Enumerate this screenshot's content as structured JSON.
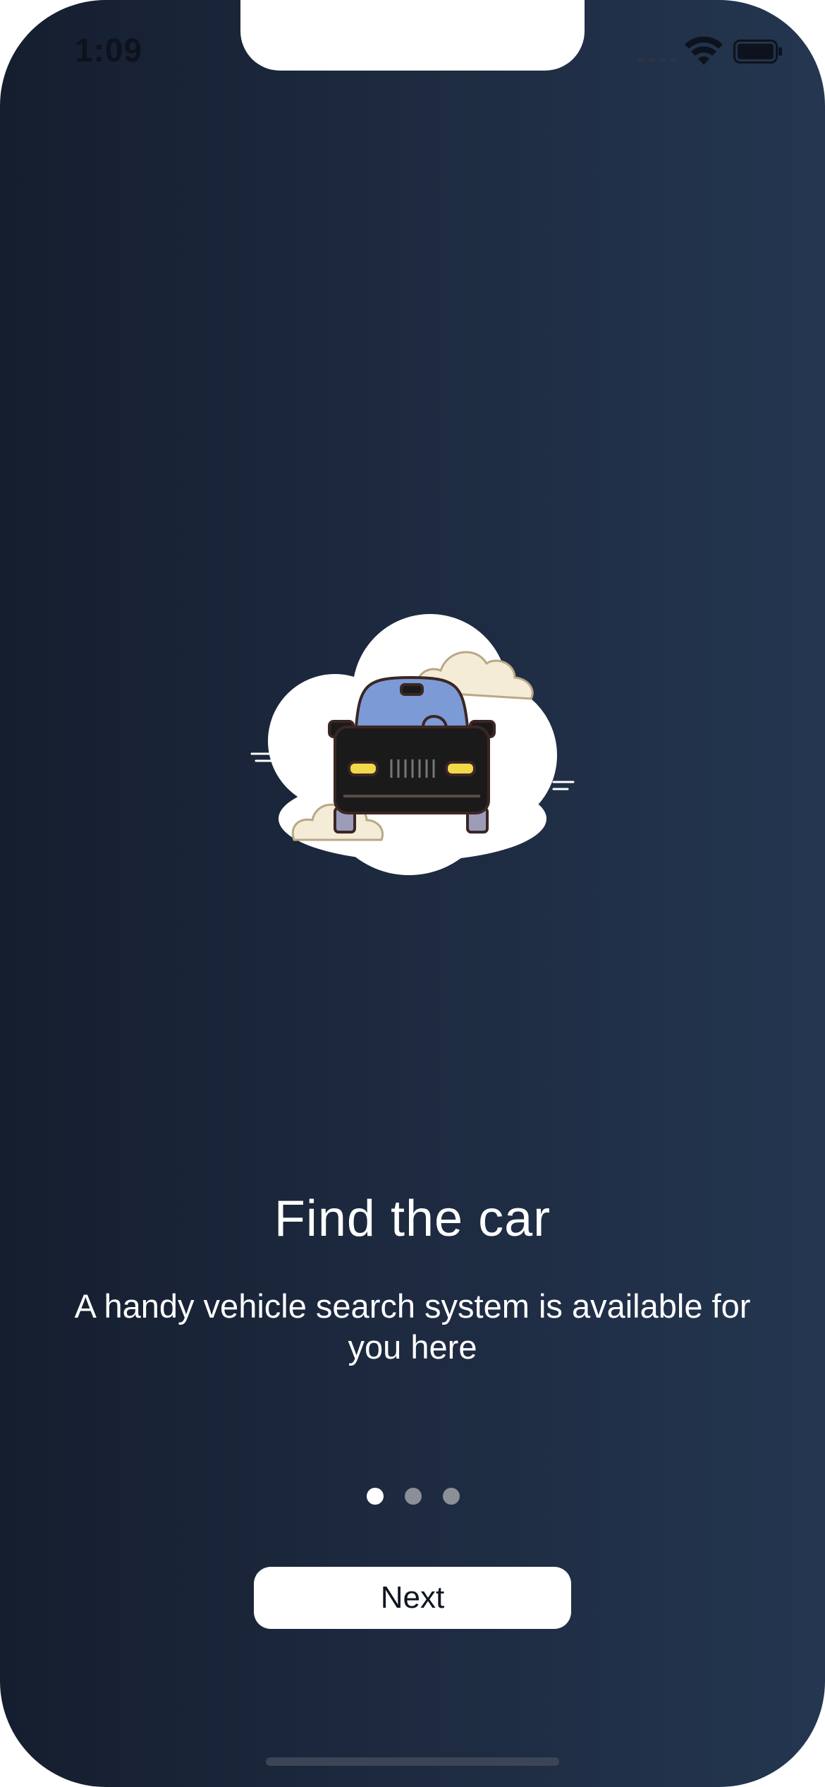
{
  "status_bar": {
    "time": "1:09"
  },
  "onboarding": {
    "title": "Find the car",
    "description": "A handy vehicle search system is available for you here",
    "page_indicator": {
      "total": 3,
      "active_index": 0
    },
    "next_label": "Next"
  },
  "icons": {
    "hero": "car-in-cloud-illustration",
    "wifi": "wifi-icon",
    "battery": "battery-icon",
    "signal": "cellular-signal-icon"
  },
  "colors": {
    "background_start": "#151e2f",
    "background_end": "#243650",
    "text": "#ffffff",
    "button_bg": "#ffffff",
    "dot_inactive": "#8a8f98"
  }
}
